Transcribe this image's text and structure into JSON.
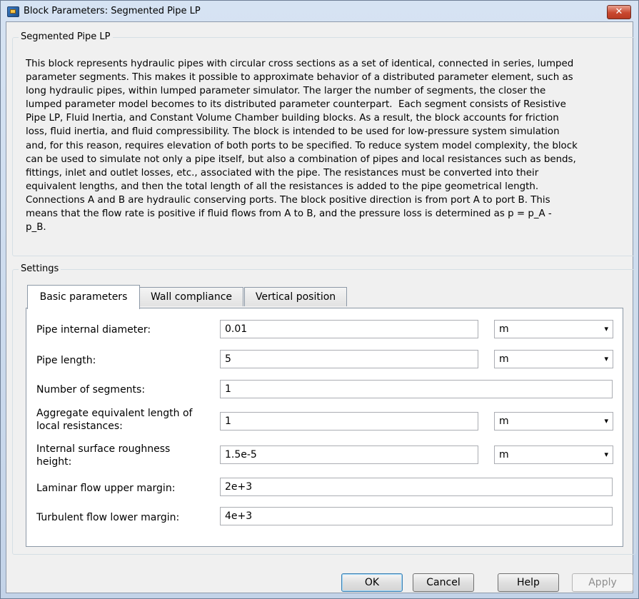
{
  "window": {
    "title": "Block Parameters: Segmented Pipe LP",
    "close_label": "✕"
  },
  "description_group": {
    "legend": "Segmented Pipe LP",
    "text": "This block represents hydraulic pipes with circular cross sections as a set of identical, connected in series, lumped\nparameter segments. This makes it possible to approximate behavior of a distributed parameter element, such as\nlong hydraulic pipes, within lumped parameter simulator. The larger the number of segments, the closer the\nlumped parameter model becomes to its distributed parameter counterpart.  Each segment consists of Resistive\nPipe LP, Fluid Inertia, and Constant Volume Chamber building blocks. As a result, the block accounts for friction\nloss, fluid inertia, and fluid compressibility. The block is intended to be used for low-pressure system simulation\nand, for this reason, requires elevation of both ports to be specified. To reduce system model complexity, the block\ncan be used to simulate not only a pipe itself, but also a combination of pipes and local resistances such as bends,\nfittings, inlet and outlet losses, etc., associated with the pipe. The resistances must be converted into their\nequivalent lengths, and then the total length of all the resistances is added to the pipe geometrical length.\nConnections A and B are hydraulic conserving ports. The block positive direction is from port A to port B. This\nmeans that the flow rate is positive if fluid flows from A to B, and the pressure loss is determined as p = p_A -\np_B."
  },
  "settings": {
    "legend": "Settings",
    "tabs": [
      {
        "label": "Basic parameters"
      },
      {
        "label": "Wall compliance"
      },
      {
        "label": "Vertical position"
      }
    ],
    "params": [
      {
        "label": "Pipe internal diameter:",
        "value": "0.01",
        "unit": "m"
      },
      {
        "label": "Pipe length:",
        "value": "5",
        "unit": "m"
      },
      {
        "label": "Number of segments:",
        "value": "1"
      },
      {
        "label": "Aggregate equivalent length of\nlocal resistances:",
        "value": "1",
        "unit": "m"
      },
      {
        "label": "Internal surface roughness\nheight:",
        "value": "1.5e-5",
        "unit": "m"
      },
      {
        "label": "Laminar flow upper margin:",
        "value": "2e+3"
      },
      {
        "label": "Turbulent flow lower margin:",
        "value": "4e+3"
      }
    ]
  },
  "buttons": {
    "ok": "OK",
    "cancel": "Cancel",
    "help": "Help",
    "apply": "Apply"
  },
  "icons": {
    "dropdown": "▾"
  }
}
